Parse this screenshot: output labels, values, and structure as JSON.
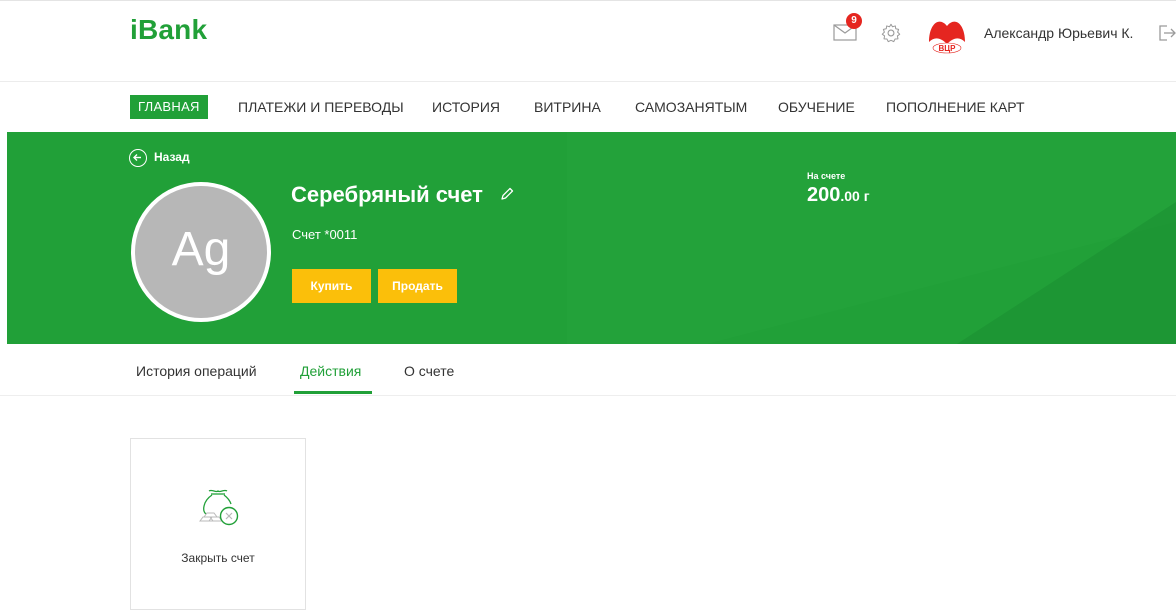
{
  "header": {
    "logo": "iBank",
    "mail_badge_count": "9",
    "user_name": "Александр Юрьевич К.",
    "avatar_logo_text": "ВЦР"
  },
  "nav": {
    "items": [
      {
        "label": "ГЛАВНАЯ",
        "active": true
      },
      {
        "label": "ПЛАТЕЖИ И ПЕРЕВОДЫ"
      },
      {
        "label": "ИСТОРИЯ"
      },
      {
        "label": "ВИТРИНА"
      },
      {
        "label": "САМОЗАНЯТЫМ"
      },
      {
        "label": "ОБУЧЕНИЕ"
      },
      {
        "label": "ПОПОЛНЕНИЕ КАРТ"
      }
    ]
  },
  "hero": {
    "back_label": "Назад",
    "avatar_text": "Ag",
    "account_title": "Серебряный счет",
    "account_number": "Счет *0011",
    "buy_label": "Купить",
    "sell_label": "Продать",
    "balance_label": "На счете",
    "balance_int": "200",
    "balance_frac": ".00 г"
  },
  "tabs": [
    {
      "label": "История операций"
    },
    {
      "label": "Действия",
      "active": true
    },
    {
      "label": "О счете"
    }
  ],
  "actions": [
    {
      "label": "Закрыть счет",
      "icon": "close-account-icon"
    }
  ],
  "colors": {
    "brand_green": "#21a038",
    "button_yellow": "#fbbf0a",
    "badge_red": "#e52620",
    "avatar_gray": "#b7b7b7"
  }
}
